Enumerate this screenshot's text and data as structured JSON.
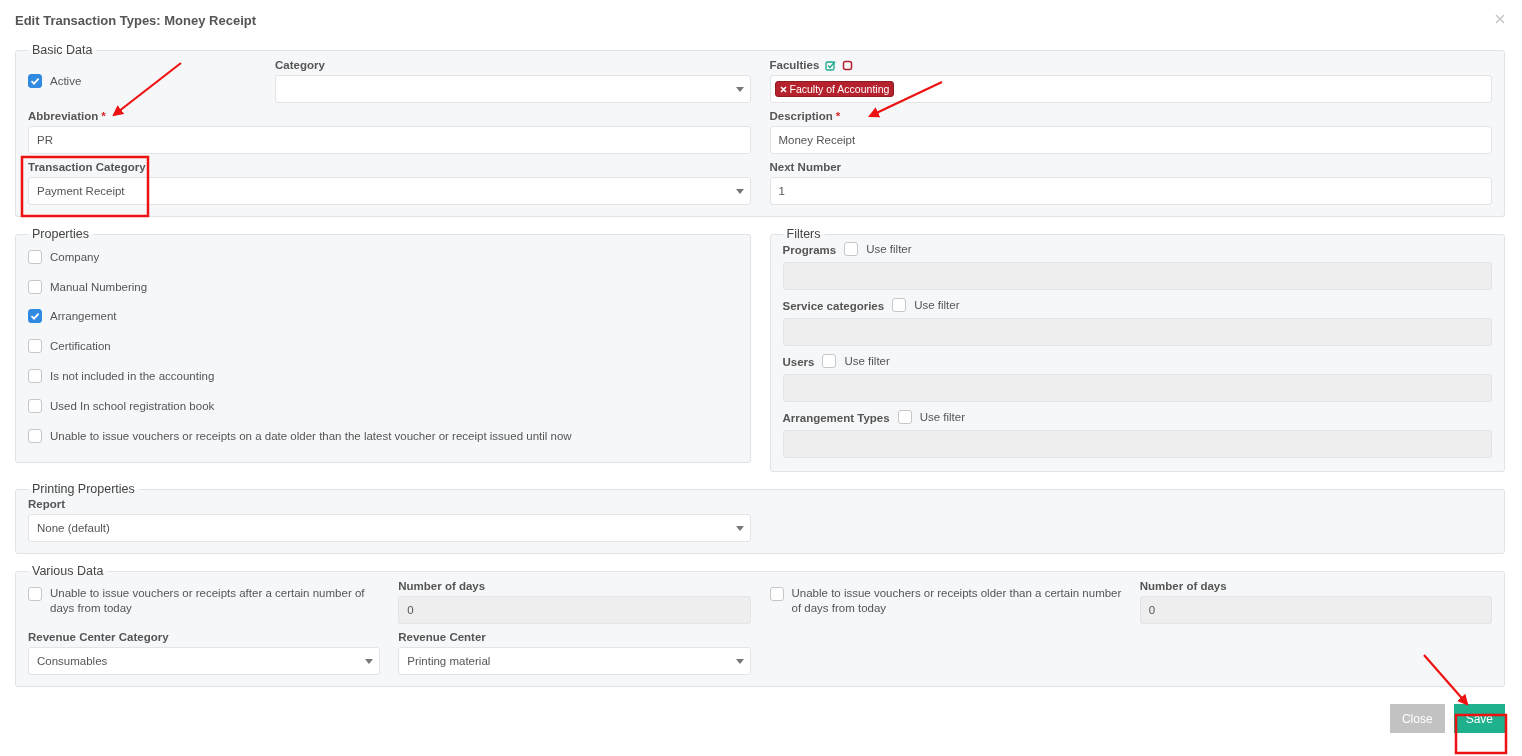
{
  "dialog": {
    "title": "Edit Transaction Types: Money Receipt"
  },
  "basic_data": {
    "legend": "Basic Data",
    "active": {
      "label": "Active",
      "checked": true
    },
    "category": {
      "label": "Category"
    },
    "faculties": {
      "label": "Faculties",
      "tags": [
        {
          "label": "Faculty of Accounting"
        }
      ]
    },
    "abbreviation": {
      "label": "Abbreviation",
      "required_mark": "*",
      "value": "PR"
    },
    "description": {
      "label": "Description",
      "required_mark": "*",
      "value": "Money Receipt"
    },
    "transaction_category": {
      "label": "Transaction Category",
      "value": "Payment Receipt"
    },
    "next_number": {
      "label": "Next Number",
      "value": "1"
    }
  },
  "properties": {
    "legend": "Properties",
    "items": [
      {
        "label": "Company",
        "checked": false
      },
      {
        "label": "Manual Numbering",
        "checked": false
      },
      {
        "label": "Arrangement",
        "checked": true
      },
      {
        "label": "Certification",
        "checked": false
      },
      {
        "label": "Is not included in the accounting",
        "checked": false
      },
      {
        "label": "Used In school registration book",
        "checked": false
      },
      {
        "label": "Unable to issue vouchers or receipts on a date older than the latest voucher or receipt issued until now",
        "checked": false
      }
    ]
  },
  "filters": {
    "legend": "Filters",
    "items": [
      {
        "label": "Programs",
        "use_filter": {
          "label": "Use filter",
          "checked": false
        }
      },
      {
        "label": "Service categories",
        "use_filter": {
          "label": "Use filter",
          "checked": false
        }
      },
      {
        "label": "Users",
        "use_filter": {
          "label": "Use filter",
          "checked": false
        }
      },
      {
        "label": "Arrangement Types",
        "use_filter": {
          "label": "Use filter",
          "checked": false
        }
      }
    ]
  },
  "printing_properties": {
    "legend": "Printing Properties",
    "report": {
      "label": "Report",
      "value": "None (default)"
    }
  },
  "various_data": {
    "legend": "Various Data",
    "limits": [
      {
        "label": "Unable to issue vouchers or receipts after a certain number of days from today",
        "checked": false,
        "days": {
          "label": "Number of days",
          "value": "0"
        }
      },
      {
        "label": "Unable to issue vouchers or receipts older than a certain number of days from today",
        "checked": false,
        "days": {
          "label": "Number of days",
          "value": "0"
        }
      }
    ],
    "revenue_center_category": {
      "label": "Revenue Center Category",
      "value": "Consumables"
    },
    "revenue_center": {
      "label": "Revenue Center",
      "value": "Printing material"
    }
  },
  "buttons": [
    {
      "label": "Close",
      "kind": "secondary"
    },
    {
      "label": "Save",
      "kind": "primary"
    }
  ]
}
